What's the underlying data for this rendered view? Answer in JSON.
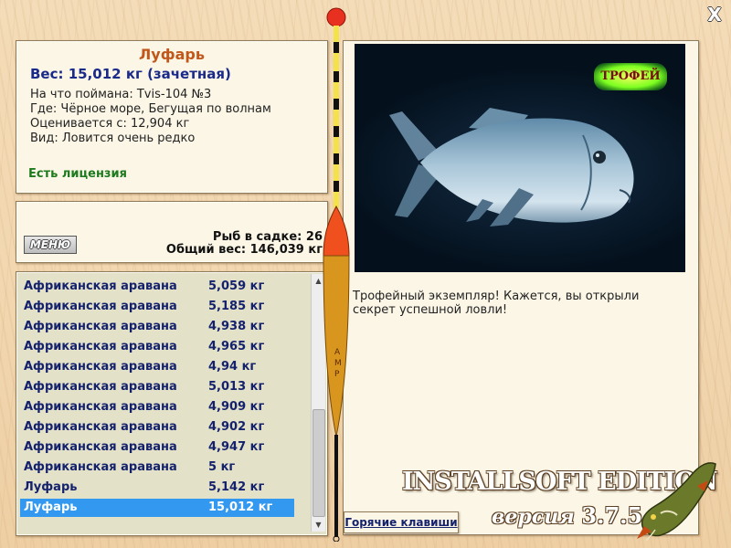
{
  "window": {
    "close_symbol": "X"
  },
  "fish_info": {
    "name": "Луфарь",
    "weight_line": "Вес: 15,012 кг (зачетная)",
    "caught_on": "На что поймана: Tvis-104 №3",
    "where": "Где: Чёрное море, Бегущая по волнам",
    "valued_from": "Оценивается с: 12,904 кг",
    "kind": "Вид: Ловится очень редко",
    "license": "Есть лицензия"
  },
  "keepnet_stats": {
    "menu_label": "МЕНЮ",
    "fish_count": "Рыб в садке: 26",
    "total_weight": "Общий вес: 146,039 кг"
  },
  "catch_list": {
    "rows": [
      {
        "name": "Африканская аравана",
        "weight": "5,059 кг"
      },
      {
        "name": "Африканская аравана",
        "weight": "5,185 кг"
      },
      {
        "name": "Африканская аравана",
        "weight": "4,938 кг"
      },
      {
        "name": "Африканская аравана",
        "weight": "4,965 кг"
      },
      {
        "name": "Африканская аравана",
        "weight": "4,94 кг"
      },
      {
        "name": "Африканская аравана",
        "weight": "5,013 кг"
      },
      {
        "name": "Африканская аравана",
        "weight": "4,909 кг"
      },
      {
        "name": "Африканская аравана",
        "weight": "4,902 кг"
      },
      {
        "name": "Африканская аравана",
        "weight": "4,947 кг"
      },
      {
        "name": "Африканская аравана",
        "weight": "5 кг"
      },
      {
        "name": "Луфарь",
        "weight": "5,142 кг"
      },
      {
        "name": "Луфарь",
        "weight": "15,012 кг",
        "selected": true
      }
    ],
    "scroll_up_symbol": "▲",
    "scroll_down_symbol": "▼"
  },
  "preview": {
    "trophy_badge": "ТРОФЕЙ",
    "description": "Трофейный экземпляр! Кажется, вы открыли секрет успешной ловли!"
  },
  "hotkeys_label": "Горячие клавиши",
  "branding": {
    "edition": "INSTALLSOFT EDITION",
    "version_word": "версия",
    "version_number": "3.7.5"
  },
  "colors": {
    "fish_name": "#c2571a",
    "weight": "#1a2a8a",
    "license": "#1e7a1e",
    "list_text": "#14226e",
    "selection": "#3399f0"
  },
  "icons": {
    "close": "close-icon",
    "float": "fishing-float-icon",
    "pike": "pike-fish-icon"
  }
}
